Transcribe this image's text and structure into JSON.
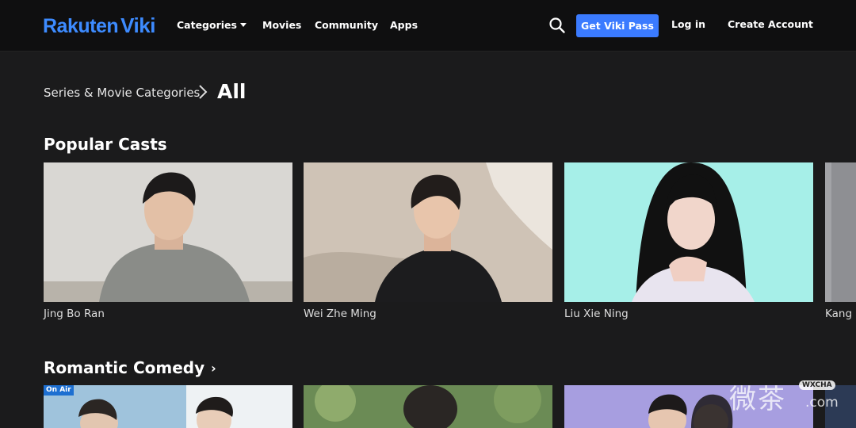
{
  "header": {
    "logo_prefix": "Rakuten",
    "logo_brand": "Viki",
    "nav": {
      "categories": "Categories",
      "movies": "Movies",
      "community": "Community",
      "apps": "Apps"
    },
    "get_pass": "Get Viki Pass",
    "login": "Log in",
    "create_account": "Create Account",
    "accent_color": "#3b7bff"
  },
  "breadcrumb": {
    "parent": "Series & Movie Categories",
    "current": "All"
  },
  "popular_casts": {
    "title": "Popular Casts",
    "items": [
      {
        "name": "Jing Bo Ran"
      },
      {
        "name": "Wei Zhe Ming"
      },
      {
        "name": "Liu Xie Ning"
      },
      {
        "name": "Kang H"
      }
    ]
  },
  "romantic_comedy": {
    "title": "Romantic Comedy",
    "badge": "On Air"
  },
  "watermark": {
    "cn": "微茶",
    "tag": "WXCHA",
    "com": ".com"
  }
}
